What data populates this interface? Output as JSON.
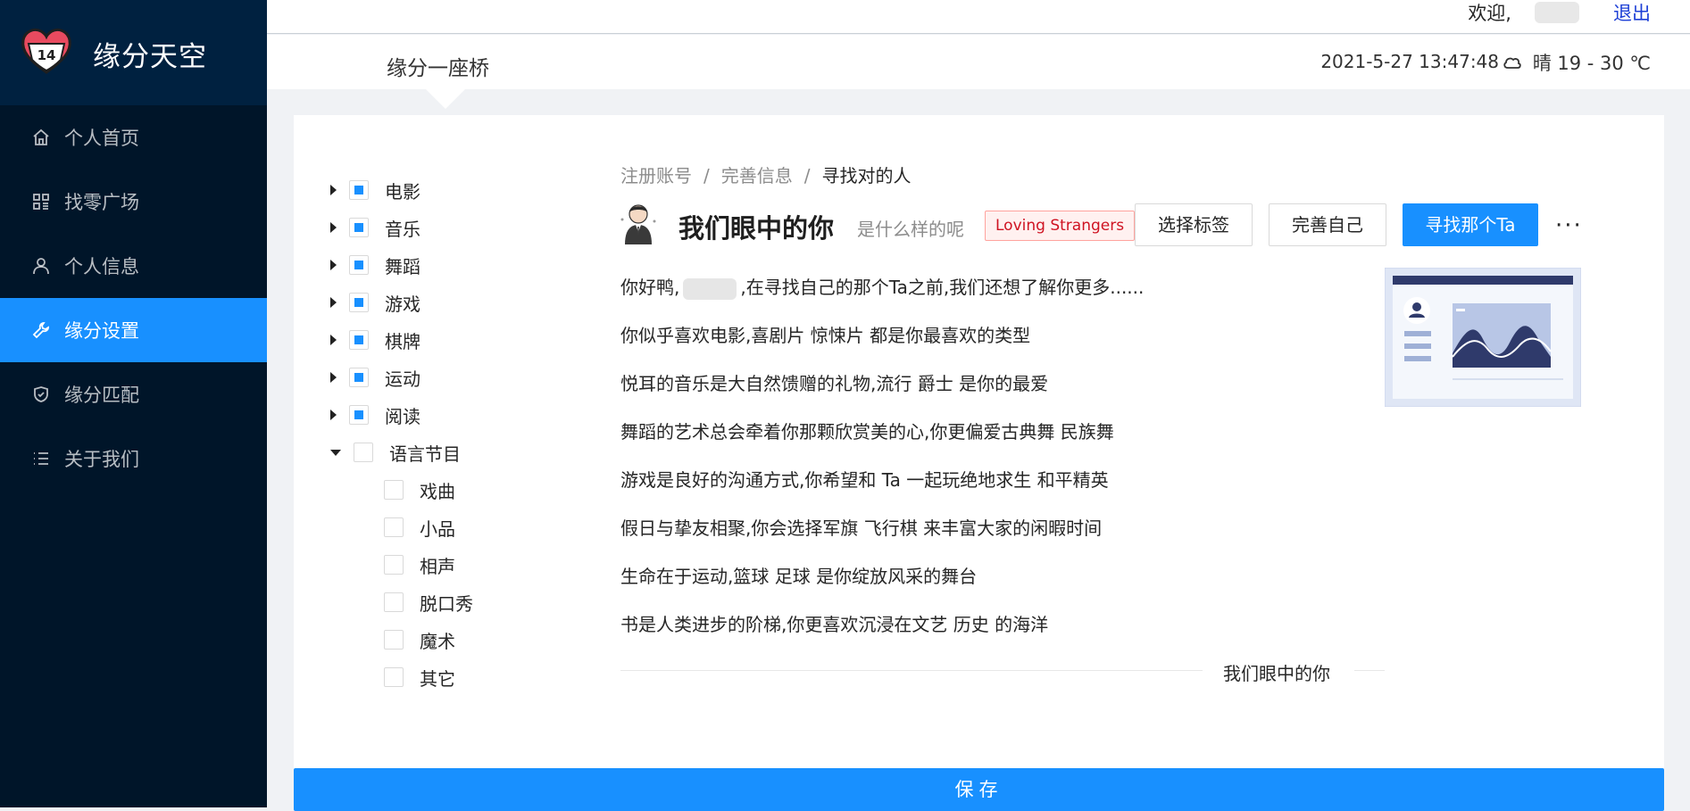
{
  "app": {
    "title": "缘分天空",
    "logo_number": "14"
  },
  "sidebar": {
    "items": [
      {
        "label": "个人首页",
        "icon": "home-icon"
      },
      {
        "label": "找零广场",
        "icon": "grid-icon"
      },
      {
        "label": "个人信息",
        "icon": "user-icon"
      },
      {
        "label": "缘分设置",
        "icon": "wrench-icon",
        "active": true
      },
      {
        "label": "缘分匹配",
        "icon": "shield-check-icon"
      },
      {
        "label": "关于我们",
        "icon": "list-icon"
      }
    ]
  },
  "topbar": {
    "welcome": "欢迎,",
    "logout": "退出"
  },
  "subheader": {
    "title": "缘分一座桥",
    "datetime": "2021-5-27 13:47:48",
    "weather": "晴 19 - 30 ℃",
    "weather_icon": "cloud-icon"
  },
  "tree": {
    "nodes": [
      {
        "label": "电影",
        "checked": true,
        "expanded": false
      },
      {
        "label": "音乐",
        "checked": true,
        "expanded": false
      },
      {
        "label": "舞蹈",
        "checked": true,
        "expanded": false
      },
      {
        "label": "游戏",
        "checked": true,
        "expanded": false
      },
      {
        "label": "棋牌",
        "checked": true,
        "expanded": false
      },
      {
        "label": "运动",
        "checked": true,
        "expanded": false
      },
      {
        "label": "阅读",
        "checked": true,
        "expanded": false
      },
      {
        "label": "语言节目",
        "checked": false,
        "expanded": true,
        "children": [
          {
            "label": "戏曲",
            "checked": false
          },
          {
            "label": "小品",
            "checked": false
          },
          {
            "label": "相声",
            "checked": false
          },
          {
            "label": "脱口秀",
            "checked": false
          },
          {
            "label": "魔术",
            "checked": false
          },
          {
            "label": "其它",
            "checked": false
          }
        ]
      }
    ]
  },
  "breadcrumb": {
    "items": [
      "注册账号",
      "完善信息",
      "寻找对的人"
    ],
    "separator": "/"
  },
  "page_header": {
    "title": "我们眼中的你",
    "subtitle": "是什么样的呢",
    "tag": "Loving Strangers",
    "buttons": {
      "select_tags": "选择标签",
      "complete_self": "完善自己",
      "find_ta": "寻找那个Ta"
    },
    "more": "···"
  },
  "content": {
    "greeting_before": "你好鸭,",
    "greeting_after": ",在寻找自己的那个Ta之前,我们还想了解你更多......",
    "lines": [
      "你似乎喜欢电影,喜剧片 惊悚片 都是你最喜欢的类型",
      "悦耳的音乐是大自然馈赠的礼物,流行 爵士 是你的最爱",
      "舞蹈的艺术总会牵着你那颗欣赏美的心,你更偏爱古典舞 民族舞",
      "游戏是良好的沟通方式,你希望和 Ta 一起玩绝地求生 和平精英",
      "假日与挚友相聚,你会选择军旗 飞行棋 来丰富大家的闲暇时间",
      "生命在于运动,篮球 足球 是你绽放风采的舞台",
      "书是人类进步的阶梯,你更喜欢沉浸在文艺 历史 的海洋"
    ],
    "divider_text": "我们眼中的你"
  },
  "save_button": "保存",
  "colors": {
    "primary": "#1890ff",
    "sidebar_bg": "#001529",
    "logo_bg": "#002140"
  }
}
